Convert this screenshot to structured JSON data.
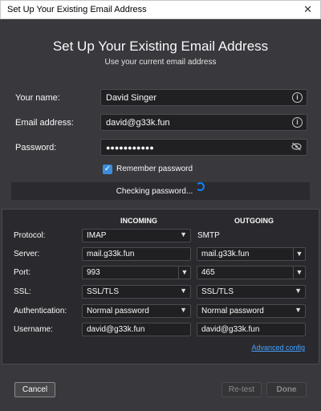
{
  "window": {
    "title": "Set Up Your Existing Email Address",
    "close_glyph": "✕"
  },
  "header": {
    "title": "Set Up Your Existing Email Address",
    "subtitle": "Use your current email address"
  },
  "account": {
    "name_label": "Your name:",
    "name_value": "David Singer",
    "email_label": "Email address:",
    "email_value": "david@g33k.fun",
    "password_label": "Password:",
    "password_value": "●●●●●●●●●●●",
    "remember_label": "Remember password",
    "remember_checked": true
  },
  "status": {
    "text": "Checking password..."
  },
  "config": {
    "incoming_header": "INCOMING",
    "outgoing_header": "OUTGOING",
    "rows": {
      "protocol": {
        "label": "Protocol:",
        "incoming": "IMAP",
        "outgoing": "SMTP"
      },
      "server": {
        "label": "Server:",
        "incoming": "mail.g33k.fun",
        "outgoing": "mail.g33k.fun"
      },
      "port": {
        "label": "Port:",
        "incoming": "993",
        "outgoing": "465"
      },
      "ssl": {
        "label": "SSL:",
        "incoming": "SSL/TLS",
        "outgoing": "SSL/TLS"
      },
      "auth": {
        "label": "Authentication:",
        "incoming": "Normal password",
        "outgoing": "Normal password"
      },
      "username": {
        "label": "Username:",
        "incoming": "david@g33k.fun",
        "outgoing": "david@g33k.fun"
      }
    },
    "advanced_link": "Advanced config"
  },
  "buttons": {
    "cancel": "Cancel",
    "retest": "Re-test",
    "done": "Done"
  },
  "icons": {
    "info": "info-icon",
    "eye": "eye-slash-icon",
    "dropdown": "chevron-down-icon",
    "spinner": "spinner-icon"
  },
  "colors": {
    "accent": "#0a84ff",
    "link": "#45a1ff",
    "checkbox": "#3b8edb"
  }
}
